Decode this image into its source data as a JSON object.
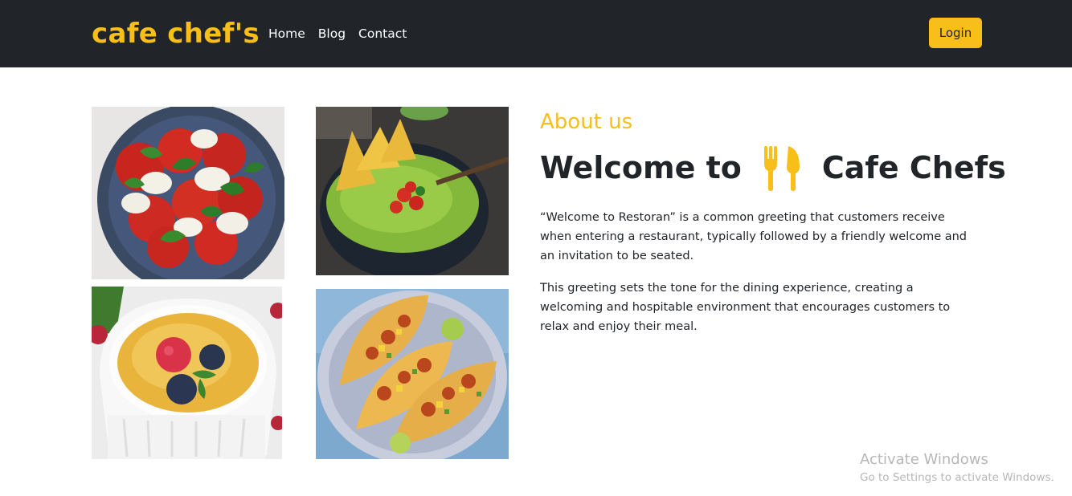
{
  "navbar": {
    "brand": "cafe chef's",
    "links": [
      "Home",
      "Blog",
      "Contact"
    ],
    "login_label": "Login"
  },
  "gallery": {
    "images": [
      {
        "name": "caprese-salad-image"
      },
      {
        "name": "guacamole-chips-image"
      },
      {
        "name": "creme-brulee-image"
      },
      {
        "name": "tacos-image"
      }
    ]
  },
  "about": {
    "eyebrow": "About us",
    "heading_prefix": "Welcome to",
    "heading_suffix": "Cafe Chefs",
    "heading_icon": "utensils-icon",
    "paragraphs": [
      "“Welcome to Restoran” is a common greeting that customers receive when entering a restaurant, typically followed by a friendly welcome and an invitation to be seated.",
      "This greeting sets the tone for the dining experience, creating a welcoming and hospitable environment that encourages customers to relax and enjoy their meal."
    ]
  },
  "watermark": {
    "title": "Activate Windows",
    "subtitle": "Go to Settings to activate Windows."
  },
  "colors": {
    "accent": "#f8be19",
    "navbar_bg": "#212529",
    "text": "#212529"
  }
}
